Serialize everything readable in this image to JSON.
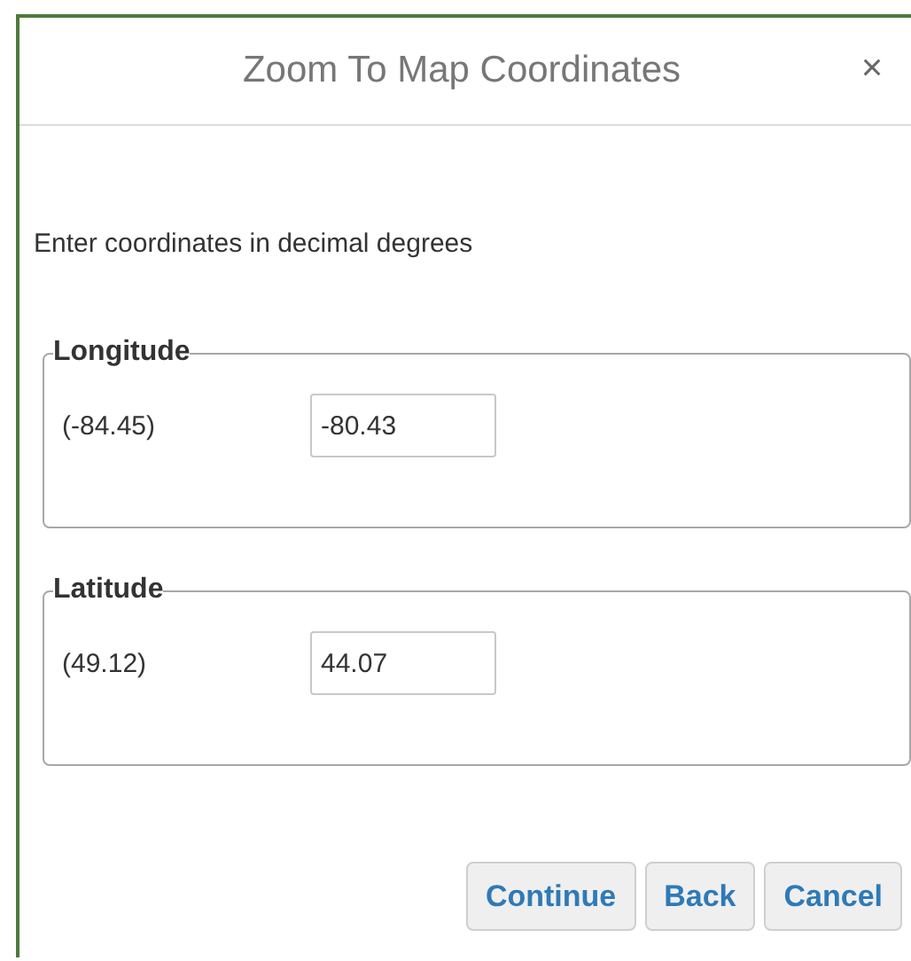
{
  "dialog": {
    "title": "Zoom To Map Coordinates",
    "close": "×"
  },
  "instruction": "Enter coordinates in decimal degrees",
  "groups": [
    {
      "legend": "Longitude",
      "hint": "(-84.45)",
      "value": "-80.43"
    },
    {
      "legend": "Latitude",
      "hint": "(49.12)",
      "value": "44.07"
    }
  ],
  "buttons": [
    "Continue",
    "Back",
    "Cancel"
  ]
}
